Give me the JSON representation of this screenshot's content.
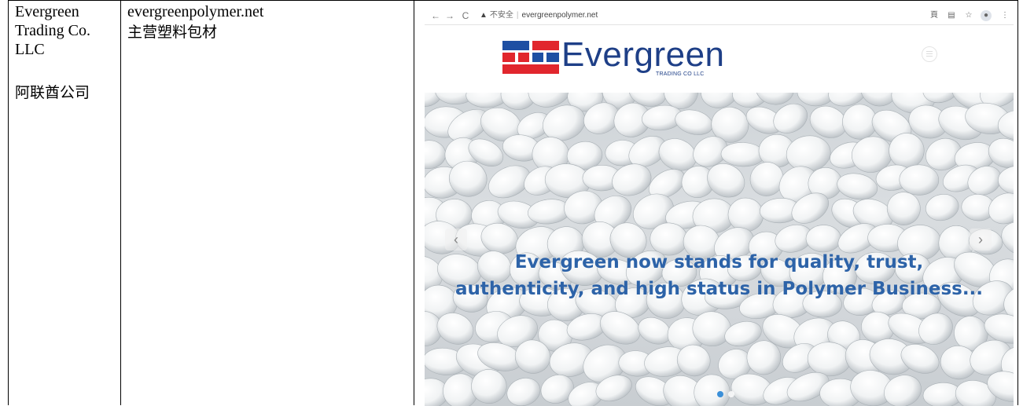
{
  "table": {
    "company_en": "Evergreen Trading Co. LLC",
    "company_cn": "阿联酋公司",
    "website": "evergreenpolymer.net",
    "business": "主营塑料包材"
  },
  "browser": {
    "back_icon": "arrow-left-icon",
    "forward_icon": "arrow-right-icon",
    "reload_icon": "reload-icon",
    "security_icon": "warning-triangle-icon",
    "security_label": "不安全",
    "url": "evergreenpolymer.net",
    "toolbar_icons": [
      "translate-icon",
      "reader-icon",
      "bookmark-star-icon",
      "profile-icon",
      "more-menu-icon"
    ]
  },
  "site": {
    "logo_word": "Evergreen",
    "logo_sub": "TRADING CO LLC",
    "logo_colors": {
      "blue": "#1e4fa3",
      "red": "#e1262d"
    },
    "hero_caption_line1": "Evergreen now stands for quality, trust,",
    "hero_caption_line2": "authenticity, and high status in Polymer Business...",
    "prev_arrow": "‹",
    "next_arrow": "›",
    "carousel_active_index": 0,
    "caption_color": "#2d63a8"
  }
}
